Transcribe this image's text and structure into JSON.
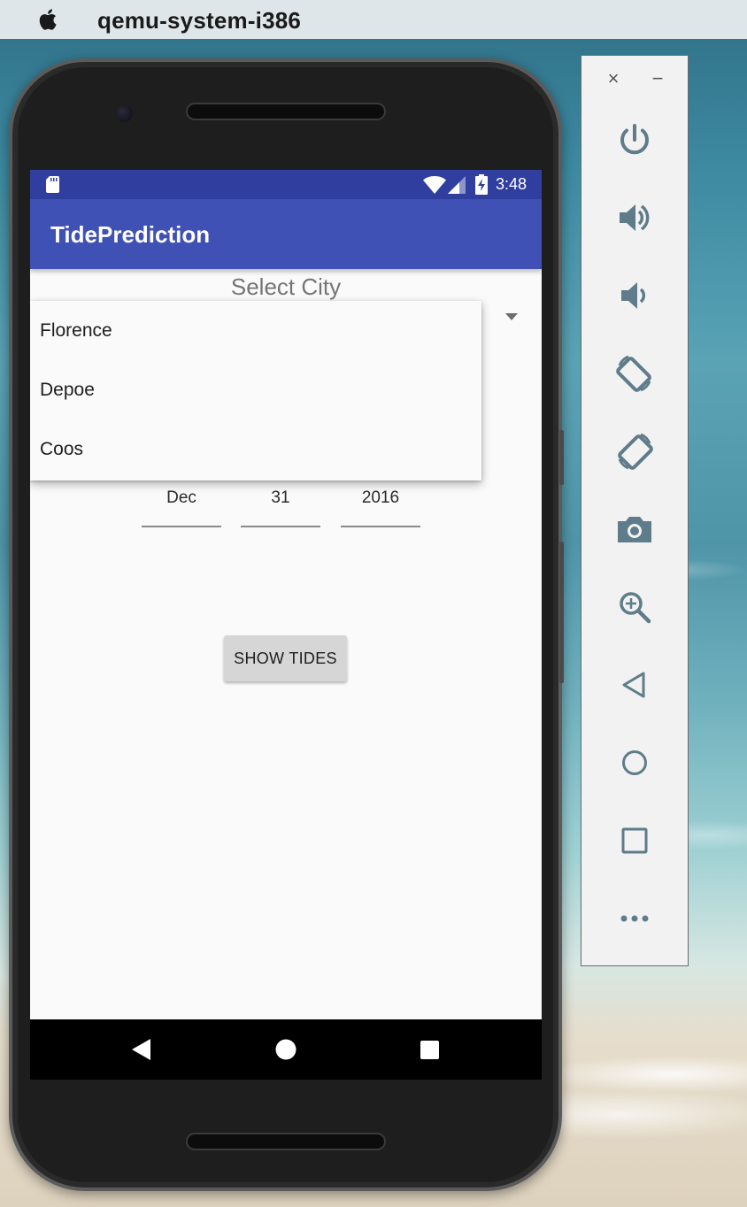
{
  "menubar": {
    "app_name": "qemu-system-i386",
    "apple_icon": "apple-icon"
  },
  "statusbar": {
    "time": "3:48",
    "icons": [
      "sd-card-icon",
      "wifi-icon",
      "signal-icon",
      "battery-charging-icon"
    ]
  },
  "app": {
    "title": "TidePrediction",
    "select_label": "Select City",
    "dropdown": {
      "options": [
        "Florence",
        "Depoe",
        "Coos"
      ]
    },
    "date": {
      "month": "Dec",
      "day": "31",
      "year": "2016"
    },
    "show_button_label": "SHOW TIDES"
  },
  "navbar": {
    "icons": [
      "back-icon",
      "home-icon",
      "recents-icon"
    ]
  },
  "emulator_panel": {
    "close_label": "×",
    "minimize_label": "−",
    "tools": [
      "power-icon",
      "volume-up-icon",
      "volume-down-icon",
      "rotate-left-icon",
      "rotate-right-icon",
      "camera-icon",
      "zoom-icon",
      "back-icon",
      "home-icon",
      "overview-icon",
      "more-icon"
    ]
  },
  "colors": {
    "primary": "#3f51b5",
    "primary_dark": "#303f9f",
    "panel_icon": "#5f7c8a"
  }
}
